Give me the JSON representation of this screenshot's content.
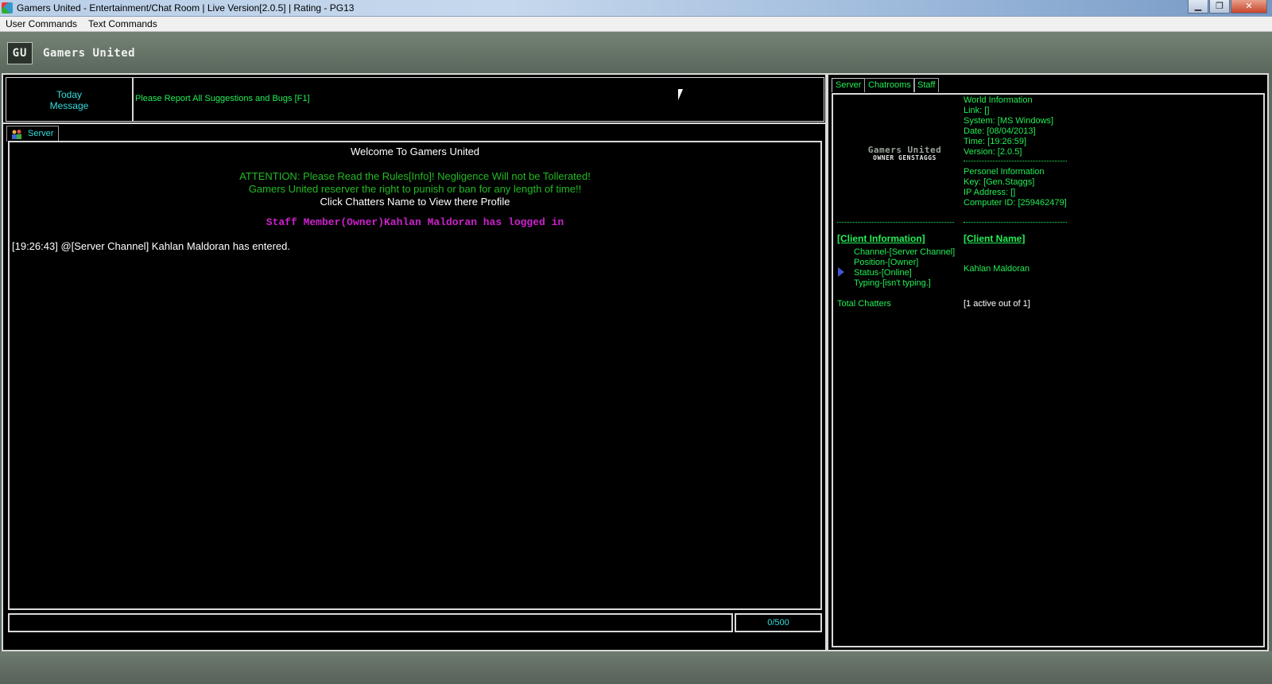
{
  "window": {
    "title": "Gamers United - Entertainment/Chat Room |  Live Version[2.0.5] | Rating  - PG13",
    "min_glyph": "▁",
    "max_glyph": "❐",
    "close_glyph": "✕"
  },
  "menu": {
    "items": [
      "User Commands",
      "Text Commands"
    ]
  },
  "header": {
    "logo_abbr": "GU",
    "logo_name": "Gamers United"
  },
  "motd": {
    "label_line1": "Today",
    "label_line2": "Message",
    "text": "Please Report All Suggestions and Bugs [F1]"
  },
  "left_tab": {
    "label": "Server"
  },
  "chat": {
    "welcome": "Welcome To Gamers United",
    "attention_line1": "ATTENTION: Please Read the Rules[Info]!  Negligence Will not be Tollerated!",
    "attention_line2": "Gamers United reserver the right to punish or ban for any length of time!!",
    "click_line": "Click Chatters Name to View there Profile",
    "staff_login": "Staff Member(Owner)Kahlan Maldoran has logged in",
    "entered_line": "[19:26:43] @[Server Channel] Kahlan Maldoran has entered."
  },
  "input": {
    "char_count": "0/500"
  },
  "right_tabs": [
    "Server",
    "Chatrooms",
    "Staff"
  ],
  "profile_logo": {
    "top": "Gamers United",
    "bottom": "OWNER GENSTAGGS"
  },
  "world_info": {
    "heading": "World Information",
    "link": "Link: []",
    "system": "System: [MS Windows]",
    "date": "Date: [08/04/2013]",
    "time": "Time: [19:26:59]",
    "version": "Version: [2.0.5]"
  },
  "personel_info": {
    "heading": "Personel Information",
    "key": "Key: [Gen.Staggs]",
    "ip": "IP Address: []",
    "computer_id": "Computer ID: [259462479]"
  },
  "client": {
    "info_heading": "[Client Information]",
    "name_heading": "[Client Name]",
    "channel": "Channel-[Server Channel]",
    "position": "Position-[Owner]",
    "status": "Status-[Online]",
    "typing": "Typing-[isn't typing.]",
    "name": "Kahlan Maldoran",
    "total_label": "Total Chatters",
    "total_value": "[1 active out of 1]"
  },
  "colors": {
    "accent_green": "#22ee55",
    "accent_cyan": "#33dddd",
    "staff_magenta": "#cc22cc",
    "panel_bg": "#000000"
  }
}
